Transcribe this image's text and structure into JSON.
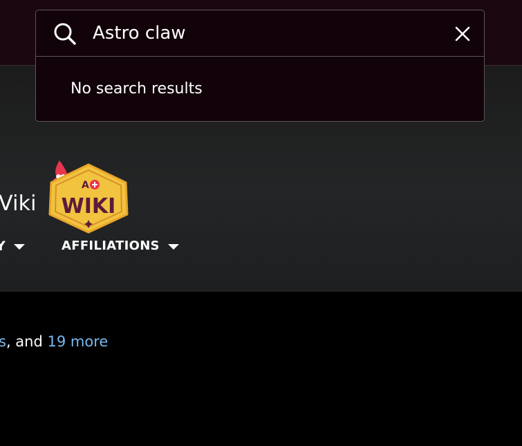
{
  "search": {
    "query": "Astro claw",
    "empty_message": "No search results"
  },
  "hero": {
    "title_fragment": "Viki",
    "nav_left_fragment": "Y",
    "nav_items": [
      {
        "label": "AFFILIATIONS"
      }
    ],
    "logo": {
      "top_text": "A",
      "word": "WIKI"
    }
  },
  "content": {
    "sentence_fragment_link": "s",
    "sentence_connector": ", and ",
    "more_link": "19 more"
  },
  "colors": {
    "topbar_bg": "#1a0710",
    "search_panel_bg": "#110309",
    "link": "#77b8ee",
    "logo_badge": "#f1c33f",
    "logo_text": "#5c1a3b",
    "logo_accent": "#e8364f"
  },
  "icons": [
    "search-icon",
    "close-icon",
    "chevron-down-icon",
    "wiki-logo"
  ]
}
